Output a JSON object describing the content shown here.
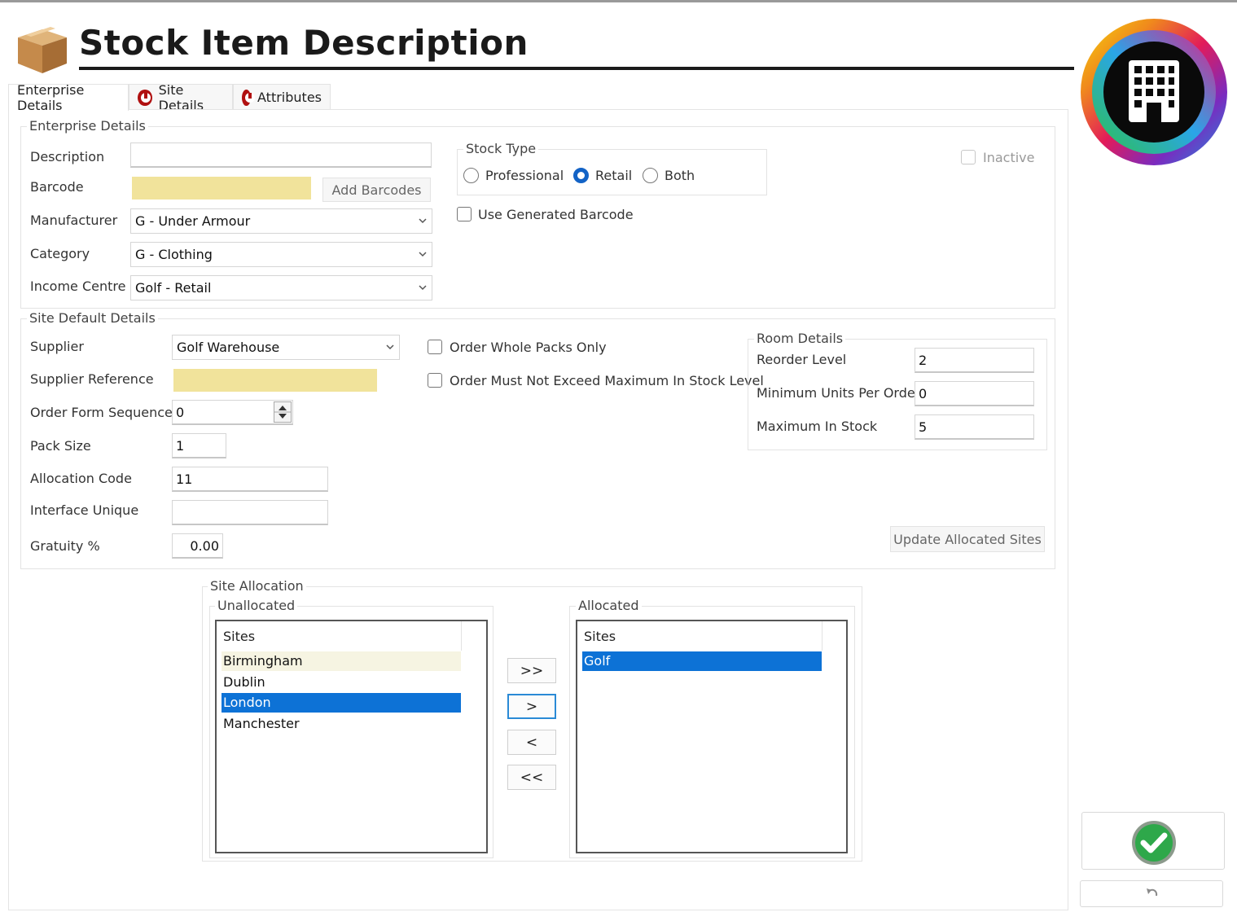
{
  "header": {
    "title": "Stock Item Description"
  },
  "tabs": [
    {
      "label": "Enterprise Details"
    },
    {
      "label": "Site Details"
    },
    {
      "label": "Attributes"
    }
  ],
  "enterprise": {
    "legend": "Enterprise Details",
    "description_label": "Description",
    "description_value": "",
    "barcode_label": "Barcode",
    "barcode_value": "",
    "add_barcodes_label": "Add Barcodes",
    "manufacturer_label": "Manufacturer",
    "manufacturer_value": "G - Under Armour",
    "category_label": "Category",
    "category_value": "G - Clothing",
    "income_centre_label": "Income Centre",
    "income_centre_value": "Golf - Retail",
    "stock_type_legend": "Stock Type",
    "stock_type_options": [
      "Professional",
      "Retail",
      "Both"
    ],
    "stock_type_selected": "Retail",
    "use_generated_barcode_label": "Use Generated Barcode",
    "use_generated_barcode_checked": false,
    "inactive_label": "Inactive",
    "inactive_checked": false
  },
  "site_default": {
    "legend": "Site Default Details",
    "supplier_label": "Supplier",
    "supplier_value": "Golf Warehouse",
    "supplier_reference_label": "Supplier Reference",
    "supplier_reference_value": "",
    "order_form_sequence_label": "Order Form Sequence",
    "order_form_sequence_value": "0",
    "pack_size_label": "Pack Size",
    "pack_size_value": "1",
    "allocation_code_label": "Allocation Code",
    "allocation_code_value": "11",
    "interface_unique_label": "Interface Unique",
    "interface_unique_value": "",
    "gratuity_label": "Gratuity %",
    "gratuity_value": "0.00",
    "order_whole_packs_label": "Order Whole Packs Only",
    "order_whole_packs_checked": false,
    "order_not_exceed_label": "Order Must Not Exceed Maximum In Stock Level",
    "order_not_exceed_checked": false,
    "room_details_legend": "Room Details",
    "reorder_level_label": "Reorder Level",
    "reorder_level_value": "2",
    "min_units_label": "Minimum Units Per Order",
    "min_units_value": "0",
    "max_in_stock_label": "Maximum In Stock",
    "max_in_stock_value": "5",
    "update_allocated_label": "Update Allocated Sites"
  },
  "site_allocation": {
    "legend": "Site Allocation",
    "unallocated_legend": "Unallocated",
    "allocated_legend": "Allocated",
    "column_header": "Sites",
    "unallocated": [
      "Birmingham",
      "Dublin",
      "London",
      "Manchester"
    ],
    "unallocated_highlighted": "Birmingham",
    "unallocated_selected": "London",
    "allocated": [
      "Golf"
    ],
    "allocated_selected": "Golf",
    "buttons": {
      "add_all": ">>",
      "add": ">",
      "remove": "<",
      "remove_all": "<<"
    }
  },
  "icons": {
    "app_logo": "box-icon",
    "brand_logo": "building-icon",
    "confirm": "check-icon",
    "undo": "undo-icon",
    "warning": "warning-icon"
  },
  "colors": {
    "selection": "#0d72d6",
    "highlight": "#f1e39b",
    "accent": "#1363c6"
  }
}
